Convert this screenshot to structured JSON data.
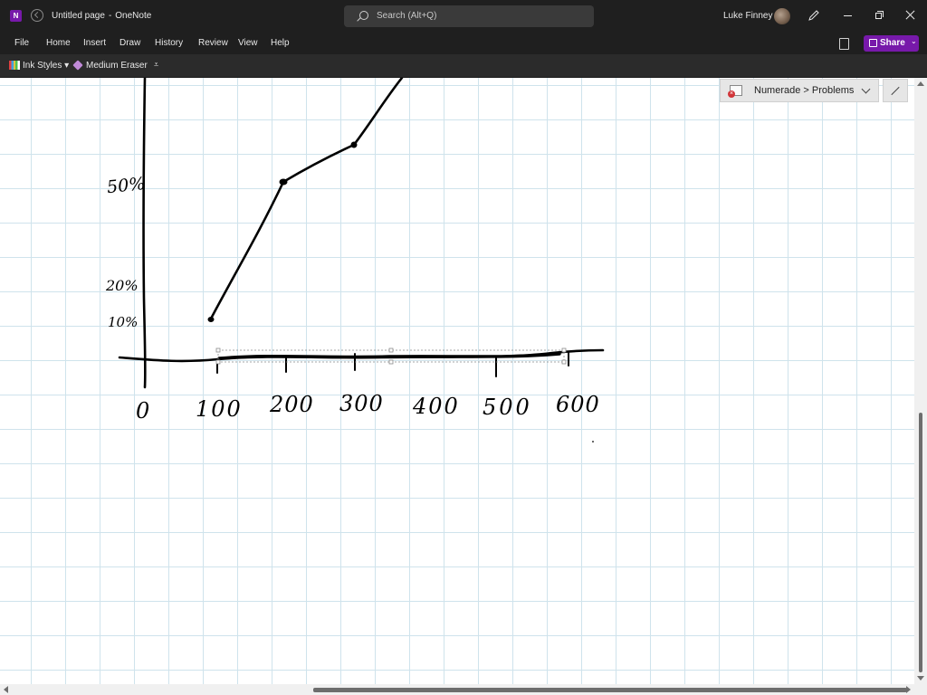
{
  "titlebar": {
    "app_icon_letter": "N",
    "page_title": "Untitled page",
    "separator": "-",
    "app_name": "OneNote",
    "search_placeholder": "Search (Alt+Q)",
    "user_name": "Luke Finney",
    "icons": [
      "onenote-app-icon",
      "back-icon",
      "search-icon",
      "avatar",
      "pen-icon",
      "minimize-icon",
      "restore-icon",
      "close-icon"
    ]
  },
  "menubar": {
    "items": [
      "File",
      "Home",
      "Insert",
      "Draw",
      "History",
      "Review",
      "View",
      "Help"
    ],
    "share_label": "Share",
    "share_chevron": "⌄"
  },
  "ribbon": {
    "ink_styles_label": "Ink Styles",
    "ink_styles_chevron": "▾",
    "eraser_label": "Medium Eraser",
    "overflow_glyph": "⩡"
  },
  "notebook": {
    "breadcrumb": "Numerade > Problems",
    "sync_error_glyph": "×"
  },
  "handwriting": {
    "y_labels": [
      "50%",
      "20%",
      "10%"
    ],
    "x_labels": [
      "0",
      "100",
      "200",
      "300",
      "400",
      "500",
      "600"
    ]
  },
  "colors": {
    "accent": "#7719aa",
    "titlebar_bg": "#1f1f1f",
    "ribbon_bg": "#2b2b2b",
    "grid_line": "#cfe3ec",
    "ink": "#000000"
  }
}
